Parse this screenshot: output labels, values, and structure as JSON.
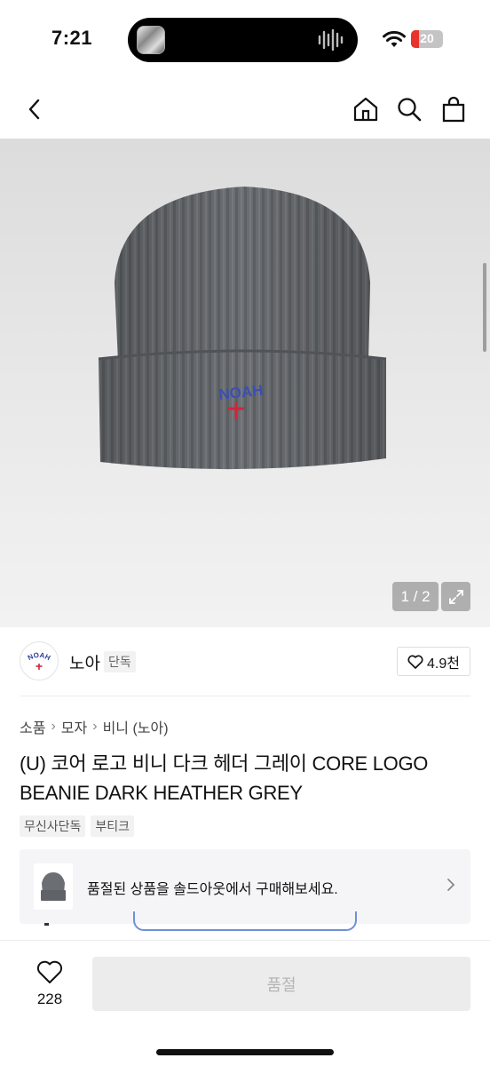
{
  "status_bar": {
    "time": "7:21",
    "battery_level": "20",
    "icons": [
      "now-playing-thumbnail-icon",
      "audio-waveform-icon",
      "wifi-icon",
      "battery-icon"
    ]
  },
  "nav": {
    "icons": [
      "back-chevron-icon",
      "home-icon",
      "search-icon",
      "shopping-bag-icon"
    ]
  },
  "gallery": {
    "page_indicator": "1 / 2",
    "expand_icon": "expand-icon"
  },
  "brand": {
    "name": "노아",
    "badge": "단독",
    "logo_text": "NOAH",
    "likes": "4.9천",
    "like_icon": "heart-outline-icon"
  },
  "breadcrumb": [
    "소품",
    "모자",
    "비니 (노아)"
  ],
  "product": {
    "title": "(U) 코어 로고 비니 다크 헤더 그레이 CORE LOGO BEANIE DARK HEATHER GREY",
    "tags": [
      "무신사단독",
      "부티크"
    ]
  },
  "soldout_banner": {
    "text": "품절된 상품을 솔드아웃에서 구매해보세요."
  },
  "bottom_bar": {
    "wish_count": "228",
    "action_label": "품절"
  },
  "colors": {
    "beanie": "#6b6e72",
    "logo_blue": "#3a4fb5",
    "logo_red": "#d0263a",
    "battery_red": "#e8322c",
    "disabled_text": "#b5b5b5"
  }
}
